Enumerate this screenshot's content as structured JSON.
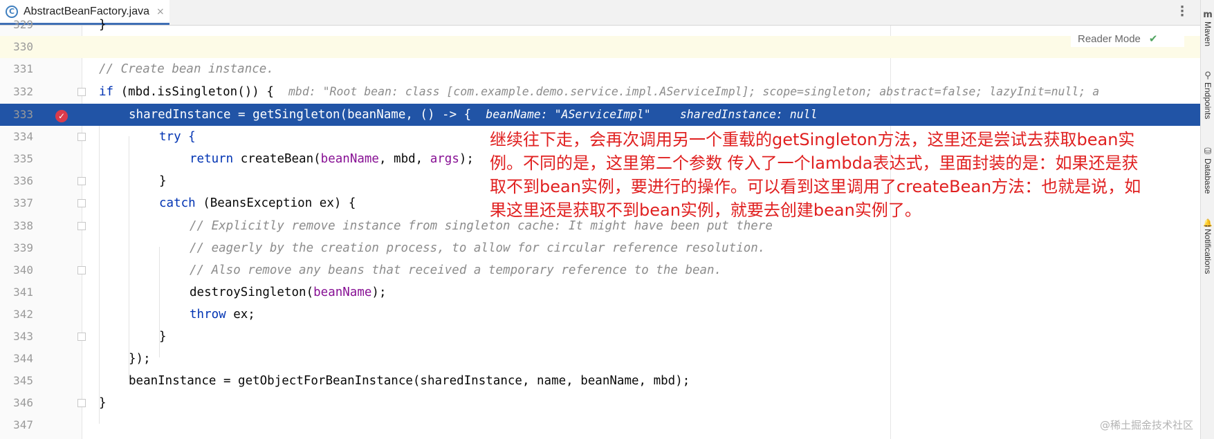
{
  "tab": {
    "icon": "C",
    "label": "AbstractBeanFactory.java",
    "close": "×"
  },
  "reader_mode": {
    "label": "Reader Mode",
    "check": "✔"
  },
  "right_tools": [
    {
      "glyph": "m",
      "label": "Maven"
    },
    {
      "glyph": "⚲",
      "label": "Endpoints"
    },
    {
      "glyph": "⛁",
      "label": "Database"
    },
    {
      "glyph": "🔔",
      "label": "Notifications"
    }
  ],
  "lines": [
    {
      "num": "329",
      "text": "}"
    },
    {
      "num": "330",
      "text": ""
    },
    {
      "num": "331",
      "text": "// Create bean instance."
    },
    {
      "num": "332",
      "text": "if (mbd.isSingleton()) {",
      "hint": "mbd: \"Root bean: class [com.example.demo.service.impl.AServiceImpl]; scope=singleton; abstract=false; lazyInit=null; a"
    },
    {
      "num": "333",
      "text": "sharedInstance = getSingleton(beanName, () -> {",
      "hint1": "beanName: \"AServiceImpl\"",
      "hint2": "sharedInstance: null"
    },
    {
      "num": "334",
      "text": "try {"
    },
    {
      "num": "335",
      "t1": "return ",
      "t2": "createBean(",
      "t3": "beanName",
      "t4": ", mbd, ",
      "t5": "args",
      "t6": ");"
    },
    {
      "num": "336",
      "text": "}"
    },
    {
      "num": "337",
      "t1": "catch ",
      "t2": "(BeansException ex) {"
    },
    {
      "num": "338",
      "text": "// Explicitly remove instance from singleton cache: It might have been put there"
    },
    {
      "num": "339",
      "text": "// eagerly by the creation process, to allow for circular reference resolution."
    },
    {
      "num": "340",
      "text": "// Also remove any beans that received a temporary reference to the bean."
    },
    {
      "num": "341",
      "t1": "destroySingleton(",
      "t2": "beanName",
      "t3": ");"
    },
    {
      "num": "342",
      "t1": "throw ",
      "t2": "ex;"
    },
    {
      "num": "343",
      "text": "}"
    },
    {
      "num": "344",
      "text": "});"
    },
    {
      "num": "345",
      "text": "beanInstance = getObjectForBeanInstance(sharedInstance, name, beanName, mbd);"
    },
    {
      "num": "346",
      "text": "}"
    },
    {
      "num": "347",
      "text": ""
    }
  ],
  "annotation": {
    "l1": "继续往下走，会再次调用另一个重载的getSingleton方法，这里还是尝试去获取bean实",
    "l2": "例。不同的是，这里第二个参数 传入了一个lambda表达式，里面封装的是：如果还是获",
    "l3": "取不到bean实例，要进行的操作。可以看到这里调用了createBean方法：也就是说，如",
    "l4": "果这里还是获取不到bean实例，就要去创建bean实例了。"
  },
  "watermark": "@稀土掘金技术社区",
  "colors": {
    "keyword": "#0033b3",
    "comment": "#8c8c8c",
    "variable": "#871094",
    "execution_line": "#2154a6",
    "annotation": "#e02020"
  }
}
